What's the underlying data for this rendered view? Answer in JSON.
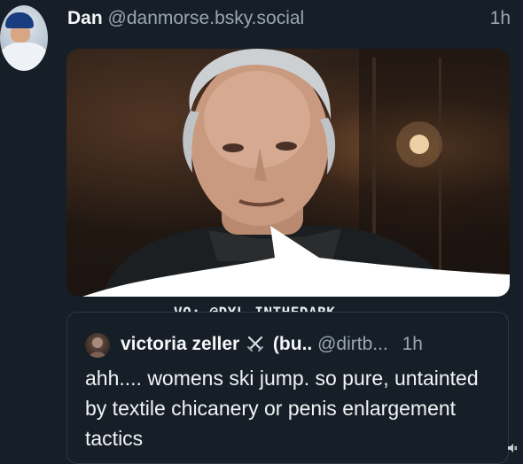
{
  "post": {
    "author": {
      "name": "Dan",
      "handle": "@danmorse.bsky.social",
      "avatar": "baseball-player-avatar"
    },
    "time": "1h",
    "media": {
      "type": "video-still",
      "subject": "older man speaking in dim room"
    }
  },
  "watermark": "VO: @DYL_INTHEDARK",
  "quote": {
    "author": {
      "name": "victoria zeller",
      "badge_icon": "crossed-swords-icon",
      "name_suffix": "(bu..",
      "handle": "@dirtb...",
      "avatar": "user-avatar"
    },
    "time": "1h",
    "text": "ahh.... womens ski jump. so pure, untainted by textile chicanery or penis enlargement tactics"
  },
  "colors": {
    "background": "#161e27",
    "muted_text": "#9aa7b4",
    "primary_text": "#f1f3f5",
    "bubble": "#ffffff"
  }
}
